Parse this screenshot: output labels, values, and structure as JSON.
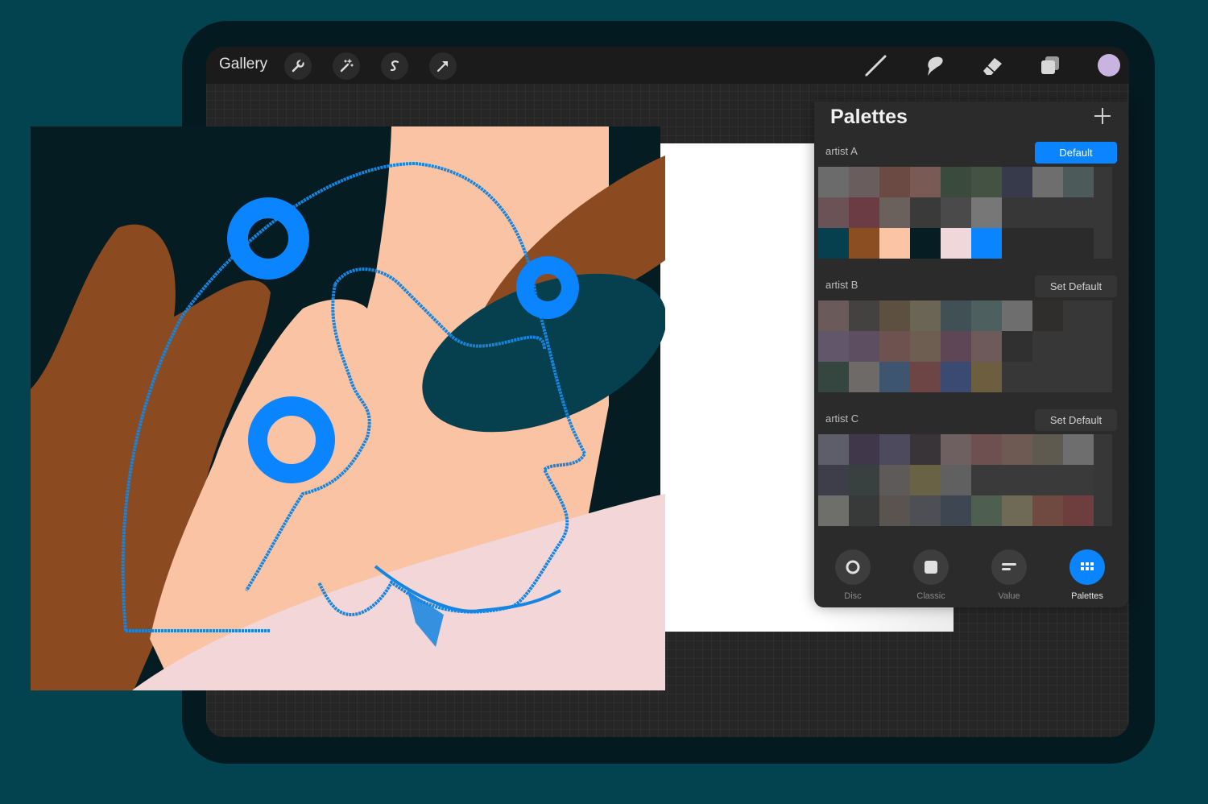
{
  "toolbar": {
    "gallery_label": "Gallery",
    "left_tools": [
      "wrench-icon",
      "magic-wand-icon",
      "selection-s-icon",
      "transform-arrow-icon"
    ],
    "right_tools": [
      "brush-icon",
      "smudge-icon",
      "eraser-icon",
      "layers-icon"
    ],
    "current_color": "#c9b3e0"
  },
  "palettes_panel": {
    "title": "Palettes",
    "palettes": [
      {
        "name": "artist A",
        "button": "Default",
        "is_default": true,
        "swatches": [
          "#6b6b6b",
          "#6a5d5d",
          "#6b4a44",
          "#7a5a55",
          "#3a4a3c",
          "#445244",
          "#363a4a",
          "#6e6e6e",
          "#4c5a5a",
          "#6a5256",
          "#6b3c44",
          "#6a615c",
          "#3a3a3a",
          "#4a4a4a",
          "#777777",
          "#373737",
          "#373737",
          "#373737",
          "#063f4d",
          "#8a4e22",
          "#fbc4a4",
          "#071d24",
          "#f0d8da",
          "#0a84ff",
          "#2b2b2b",
          "#2b2b2b",
          "#2b2b2b"
        ]
      },
      {
        "name": "artist B",
        "button": "Set Default",
        "is_default": false,
        "swatches": [
          "#6a5a5a",
          "#444240",
          "#5e5040",
          "#6a6555",
          "#405055",
          "#4e5f5f",
          "#6e6e6e",
          "#302e2c",
          "#373737",
          "#62566a",
          "#5e4e62",
          "#6e5250",
          "#6e5e52",
          "#5e4654",
          "#6e5a5a",
          "#303030",
          "#373737",
          "#373737",
          "#354540",
          "#6e6a68",
          "#3e5570",
          "#6e4545",
          "#3a4a70",
          "#6e5e40",
          "#373737",
          "#373737",
          "#373737"
        ]
      },
      {
        "name": "artist C",
        "button": "Set Default",
        "is_default": false,
        "swatches": [
          "#5e5e6a",
          "#40384a",
          "#4e4a5e",
          "#383438",
          "#6e6060",
          "#6e5050",
          "#6e5a52",
          "#5e5a50",
          "#6e6e6e",
          "#3e3e4a",
          "#384040",
          "#5e5a5a",
          "#6a6245",
          "#606060",
          "#3a3a3a",
          "#3a3a3a",
          "#3a3a3a",
          "#3a3a3a",
          "#6e6e6a",
          "#383a3a",
          "#5a5450",
          "#4e4e55",
          "#3e4652",
          "#4e5e50",
          "#6e6a55",
          "#6e4a40",
          "#6e3e3e"
        ]
      }
    ],
    "tabs": [
      {
        "label": "Disc",
        "icon": "disc-icon",
        "active": false
      },
      {
        "label": "Classic",
        "icon": "classic-square-icon",
        "active": false
      },
      {
        "label": "Value",
        "icon": "value-sliders-icon",
        "active": false
      },
      {
        "label": "Palettes",
        "icon": "palettes-grid-icon",
        "active": true
      }
    ]
  },
  "accent_color": "#0a84ff",
  "background_color": "#03434f"
}
